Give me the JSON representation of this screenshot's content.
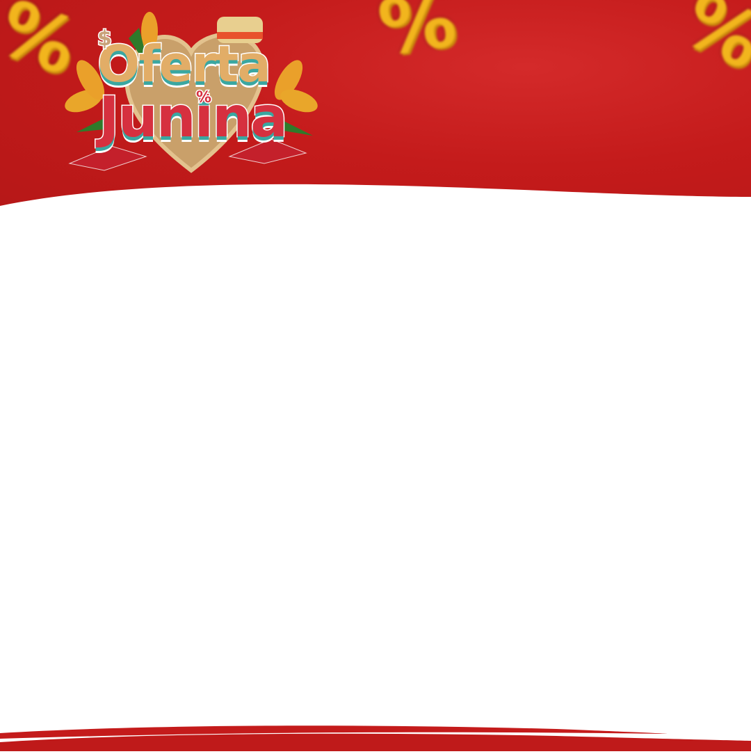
{
  "banner": {
    "logo": {
      "line1": "Oferta",
      "line2": "Junina",
      "dollar": "$",
      "percent": "%"
    },
    "decorations": [
      "percent-icon",
      "percent-icon",
      "percent-icon"
    ],
    "colors": {
      "red": "#c41b1b",
      "gold": "#f2b51d",
      "teal": "#3aa7a1",
      "tan": "#e2ad67",
      "pinkred": "#d6303f"
    }
  }
}
